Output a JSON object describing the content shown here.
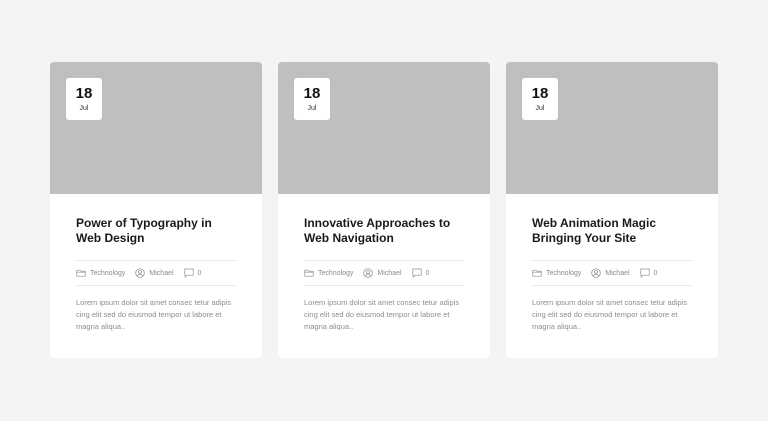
{
  "cards": [
    {
      "date": {
        "day": "18",
        "month": "Jul"
      },
      "title": "Power of Typography in Web Design",
      "category": "Technology",
      "author": "Michael",
      "comments": "0",
      "excerpt": "Lorem ipsum dolor sit amet consec tetur adipis cing elit sed do eiusmod tempor ut labore et magna aliqua.."
    },
    {
      "date": {
        "day": "18",
        "month": "Jul"
      },
      "title": "Innovative Approaches to Web Navigation",
      "category": "Technology",
      "author": "Michael",
      "comments": "0",
      "excerpt": "Lorem ipsum dolor sit amet consec tetur adipis cing elit sed do eiusmod tempor ut labore et magna aliqua.."
    },
    {
      "date": {
        "day": "18",
        "month": "Jul"
      },
      "title": "Web Animation Magic Bringing Your Site",
      "category": "Technology",
      "author": "Michael",
      "comments": "0",
      "excerpt": "Lorem ipsum dolor sit amet consec tetur adipis cing elit sed do eiusmod tempor ut labore et magna aliqua.."
    }
  ],
  "colors": {
    "page_bg": "#f4f4f4",
    "card_bg": "#ffffff",
    "thumb_bg": "#bebfc0",
    "title_text": "#1a1a1a",
    "meta_text": "#8a8a8a"
  },
  "icons": {
    "category": "folder-icon",
    "author": "user-icon",
    "comments": "comment-icon"
  }
}
